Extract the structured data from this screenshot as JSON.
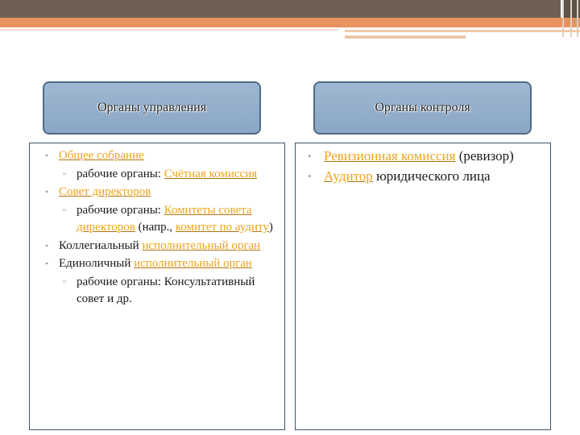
{
  "colors": {
    "band_top": "#6e6154",
    "band_orange": "#e8925f",
    "header_fill": "#8aa6c4",
    "header_border": "#4f6b87",
    "panel_border": "#42546a",
    "link": "#f0a41a",
    "bullet": "#a3a3a3"
  },
  "left": {
    "header": "Органы управления",
    "items": [
      {
        "link": "Общее собрание"
      },
      {
        "sub_text": "рабочие органы: ",
        "sub_link": "Счётная комиссия"
      },
      {
        "link": "Совет директоров"
      },
      {
        "sub_text": "рабочие органы: ",
        "sub_link": "Комитеты совета директоров",
        "sub_text2": " (напр., ",
        "sub_link2": "комитет по аудиту",
        "sub_text3": ")"
      },
      {
        "text": "Коллегиальный ",
        "link": "исполнительный орган"
      },
      {
        "text": "Единоличный ",
        "link": "исполнительный орган"
      },
      {
        "sub_text": "рабочие органы: Консультативный совет и др."
      }
    ]
  },
  "right": {
    "header": "Органы контроля",
    "items": [
      {
        "link": "Ревизионная комиссия",
        "text": " (ревизор)"
      },
      {
        "link": "Аудитор",
        "text": " юридического лица"
      }
    ]
  },
  "icons": {
    "bullet_l1": "•",
    "bullet_l2": "▫"
  }
}
